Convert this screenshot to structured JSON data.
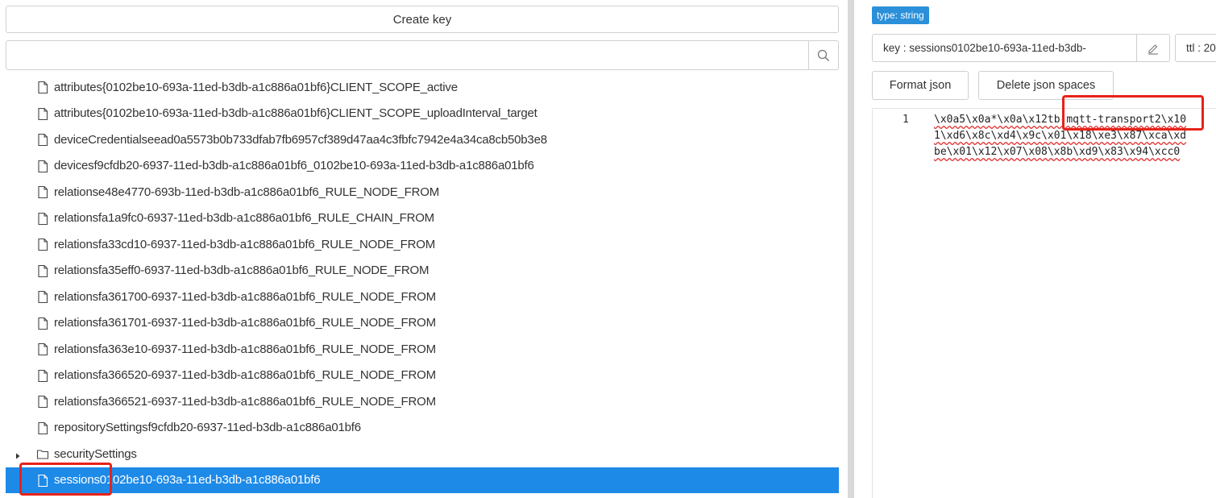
{
  "left": {
    "create_key_label": "Create key",
    "search": {
      "placeholder": "",
      "value": ""
    },
    "tree_items": [
      {
        "type": "file",
        "label": "attributes{0102be10-693a-11ed-b3db-a1c886a01bf6}CLIENT_SCOPE_active"
      },
      {
        "type": "file",
        "label": "attributes{0102be10-693a-11ed-b3db-a1c886a01bf6}CLIENT_SCOPE_uploadInterval_target"
      },
      {
        "type": "file",
        "label": "deviceCredentialseead0a5573b0b733dfab7fb6957cf389d47aa4c3fbfc7942e4a34ca8cb50b3e8"
      },
      {
        "type": "file",
        "label": "devicesf9cfdb20-6937-11ed-b3db-a1c886a01bf6_0102be10-693a-11ed-b3db-a1c886a01bf6"
      },
      {
        "type": "file",
        "label": "relationse48e4770-693b-11ed-b3db-a1c886a01bf6_RULE_NODE_FROM"
      },
      {
        "type": "file",
        "label": "relationsfa1a9fc0-6937-11ed-b3db-a1c886a01bf6_RULE_CHAIN_FROM"
      },
      {
        "type": "file",
        "label": "relationsfa33cd10-6937-11ed-b3db-a1c886a01bf6_RULE_NODE_FROM"
      },
      {
        "type": "file",
        "label": "relationsfa35eff0-6937-11ed-b3db-a1c886a01bf6_RULE_NODE_FROM"
      },
      {
        "type": "file",
        "label": "relationsfa361700-6937-11ed-b3db-a1c886a01bf6_RULE_NODE_FROM"
      },
      {
        "type": "file",
        "label": "relationsfa361701-6937-11ed-b3db-a1c886a01bf6_RULE_NODE_FROM"
      },
      {
        "type": "file",
        "label": "relationsfa363e10-6937-11ed-b3db-a1c886a01bf6_RULE_NODE_FROM"
      },
      {
        "type": "file",
        "label": "relationsfa366520-6937-11ed-b3db-a1c886a01bf6_RULE_NODE_FROM"
      },
      {
        "type": "file",
        "label": "relationsfa366521-6937-11ed-b3db-a1c886a01bf6_RULE_NODE_FROM"
      },
      {
        "type": "file",
        "label": "repositorySettingsf9cfdb20-6937-11ed-b3db-a1c886a01bf6"
      },
      {
        "type": "folder",
        "label": "securitySettings"
      },
      {
        "type": "file",
        "label": "sessions0102be10-693a-11ed-b3db-a1c886a01bf6",
        "selected": true
      }
    ]
  },
  "right": {
    "type_badge": "type: string",
    "key_text": "key : sessions0102be10-693a-11ed-b3db-",
    "ttl_text": "ttl : 20",
    "format_json_label": "Format json",
    "delete_spaces_label": "Delete json spaces",
    "editor": {
      "line_number": "1",
      "lines": [
        "\\x0a5\\x0a*\\x0a\\x12tb-mqtt-transport2\\x10",
        "1\\xd6\\x8c\\xd4\\x9c\\x01\\x18\\xe3\\x87\\xca\\xd",
        "be\\x01\\x12\\x07\\x08\\x8b\\xd9\\x83\\x94\\xcc0"
      ]
    }
  },
  "colors": {
    "selection": "#1e8ae8",
    "badge": "#2b90d9",
    "highlight": "#e8221a"
  }
}
